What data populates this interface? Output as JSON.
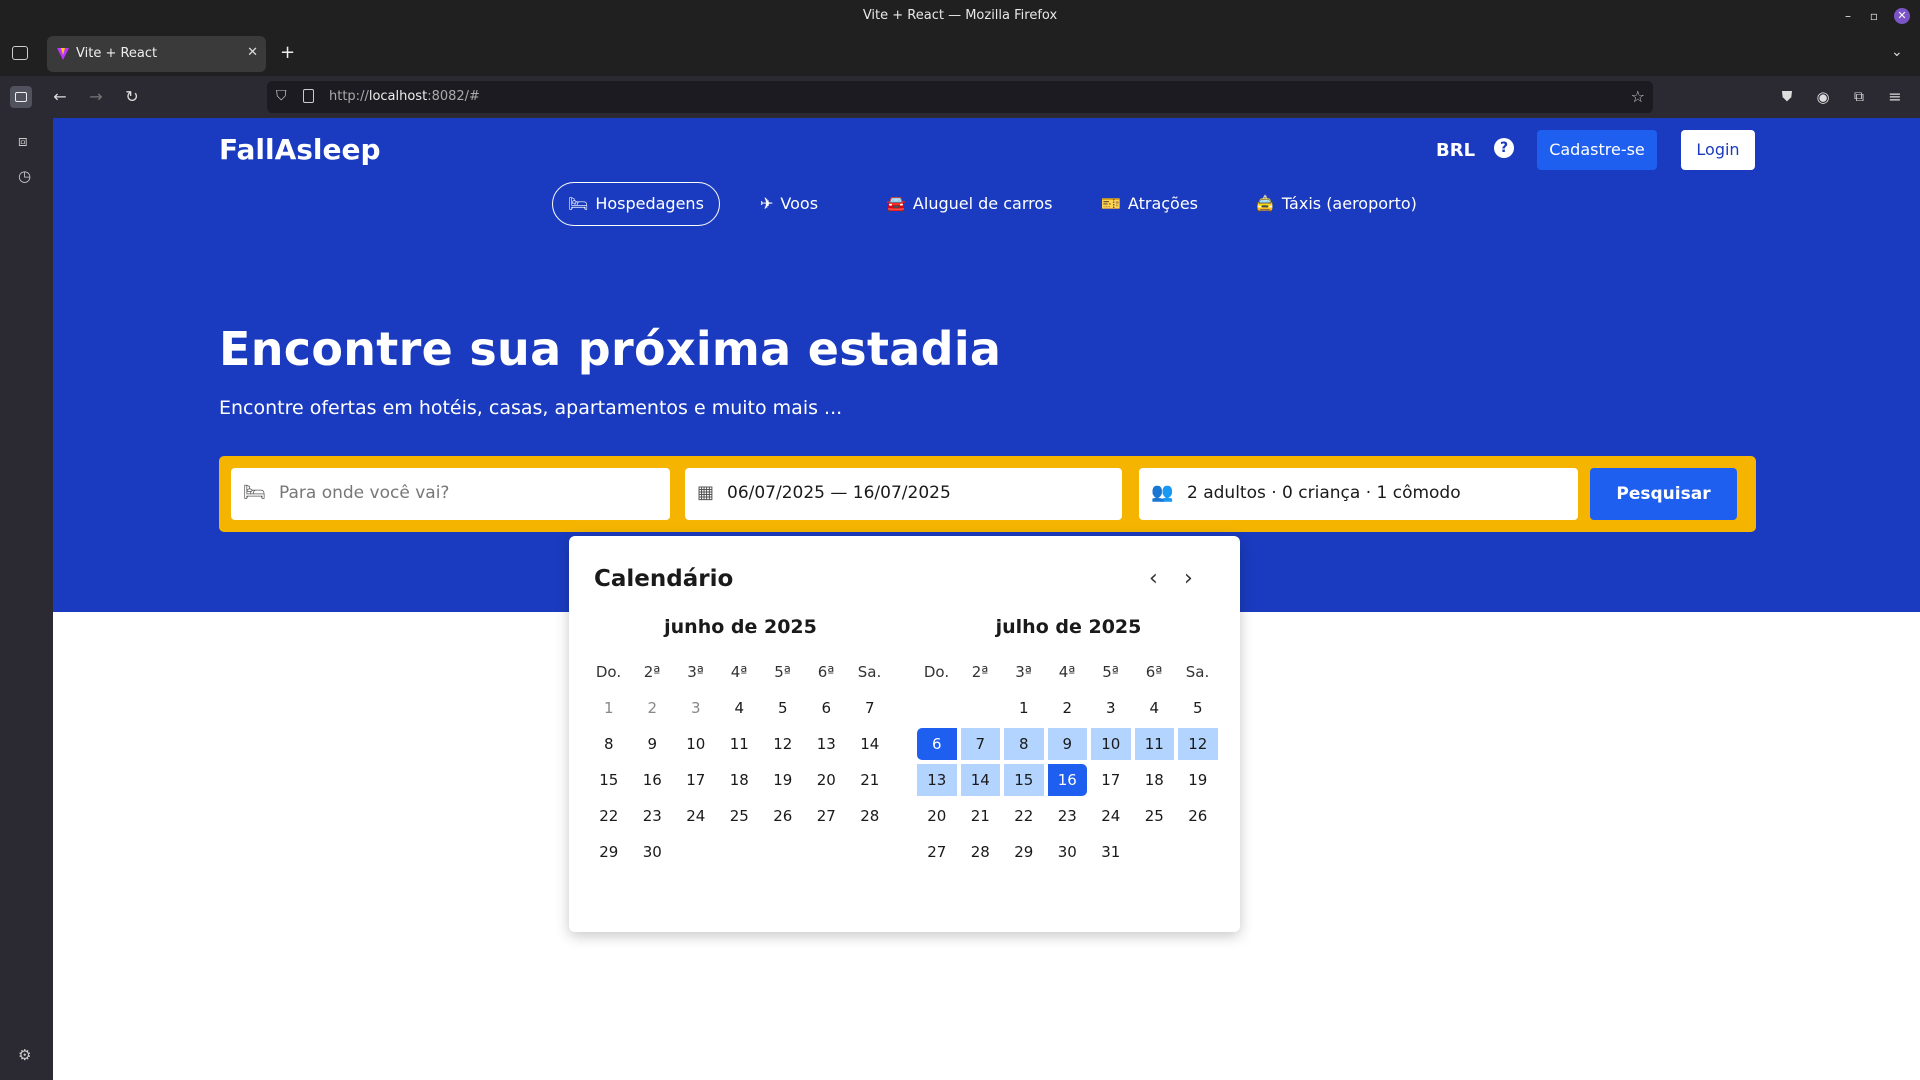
{
  "window": {
    "title": "Vite + React — Mozilla Firefox"
  },
  "tab": {
    "title": "Vite + React"
  },
  "url": {
    "prefix": "http://",
    "host": "localhost",
    "rest": ":8082/#"
  },
  "header": {
    "brand": "FallAsleep",
    "currency": "BRL",
    "help_icon": "?",
    "signup": "Cadastre-se",
    "login": "Login"
  },
  "nav": [
    {
      "label": "Hospedagens",
      "icon": "bed-icon",
      "active": true
    },
    {
      "label": "Voos",
      "icon": "plane-icon"
    },
    {
      "label": "Aluguel de carros",
      "icon": "car-icon"
    },
    {
      "label": "Atrações",
      "icon": "ticket-icon"
    },
    {
      "label": "Táxis (aeroporto)",
      "icon": "taxi-icon"
    }
  ],
  "hero": {
    "title": "Encontre sua próxima estadia",
    "subtitle": "Encontre ofertas em hotéis, casas, apartamentos e muito mais ..."
  },
  "search": {
    "destination_placeholder": "Para onde você vai?",
    "dates": "06/07/2025 — 16/07/2025",
    "guests": "2 adultos · 0 criança · 1 cômodo",
    "button": "Pesquisar"
  },
  "calendar": {
    "title": "Calendário",
    "weekdays": [
      "Do.",
      "2ª",
      "3ª",
      "4ª",
      "5ª",
      "6ª",
      "Sa."
    ],
    "months": [
      {
        "label": "junho de 2025",
        "first_weekday": 0,
        "days": 30,
        "past_until": 3
      },
      {
        "label": "julho de 2025",
        "first_weekday": 2,
        "days": 31,
        "range_start": 6,
        "range_end": 16
      }
    ]
  },
  "colors": {
    "hero_bg": "#1a3bbf",
    "search_bar": "#f4b400",
    "primary": "#1f5ff0",
    "range": "#b3d4ff"
  }
}
